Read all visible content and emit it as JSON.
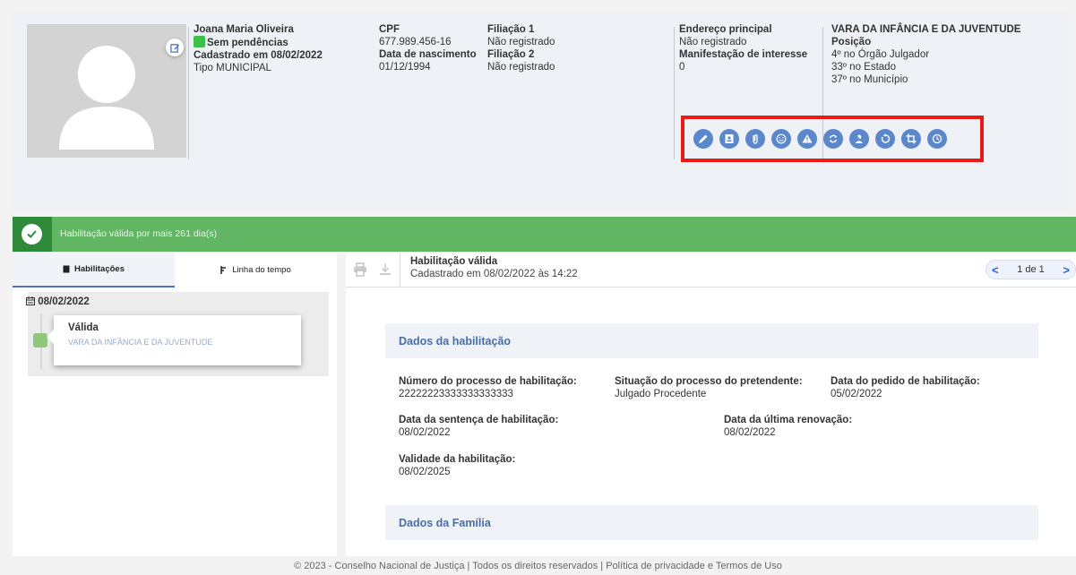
{
  "profile": {
    "name": "Joana Maria Oliveira",
    "status": "Sem pendências",
    "registered": "Cadastrado em 08/02/2022",
    "type": "Tipo MUNICIPAL",
    "cpf_label": "CPF",
    "cpf": "677.989.456-16",
    "birth_label": "Data de nascimento",
    "birth": "01/12/1994",
    "filiacao1_label": "Filiação 1",
    "filiacao1": "Não registrado",
    "filiacao2_label": "Filiação 2",
    "filiacao2": "Não registrado",
    "address_label": "Endereço principal",
    "address": "Não registrado",
    "interest_label": "Manifestação de interesse",
    "interest": "0",
    "court": "VARA DA INFÂNCIA E DA JUVENTUDE",
    "position_label": "Posição",
    "positions": [
      "4º no Órgão Julgador",
      "33º no Estado",
      "37º no Município"
    ],
    "status_color": "#3cc04c"
  },
  "actions": [
    "pencil-icon",
    "contact-card-icon",
    "paperclip-icon",
    "smiley-icon",
    "warning-icon",
    "refresh-icon",
    "user-slash-icon",
    "undo-icon",
    "crop-icon",
    "history-icon"
  ],
  "banner": {
    "text": "Habilitação válida por mais 261 dia(s)",
    "color": "#62b562"
  },
  "tabs": {
    "habilitacoes": "Habilitações",
    "timeline": "Linha do tempo"
  },
  "timeline": {
    "date": "08/02/2022",
    "title": "Válida",
    "subtitle": "VARA DA INFÂNCIA E DA JUVENTUDE"
  },
  "detail": {
    "title": "Habilitação válida",
    "subtitle": "Cadastrado em 08/02/2022 às 14:22",
    "pager": "1 de 1",
    "section1": "Dados da habilitação",
    "section2": "Dados da Família",
    "fields": {
      "processo_label": "Número do processo de habilitação:",
      "processo": "22222223333333333333",
      "situacao_label": "Situação do processo do pretendente:",
      "situacao": "Julgado Procedente",
      "pedido_label": "Data do pedido de habilitação:",
      "pedido": "05/02/2022",
      "sentenca_label": "Data da sentença de habilitação:",
      "sentenca": "08/02/2022",
      "renovacao_label": "Data da última renovação:",
      "renovacao": "08/02/2022",
      "validade_label": "Validade da habilitação:",
      "validade": "08/02/2025"
    }
  },
  "footer": "© 2023 - Conselho Nacional de Justiça | Todos os direitos reservados | Política de privacidade e Termos de Uso",
  "colors": {
    "accent": "#5b87cb",
    "highlight_border": "#e81a1a"
  }
}
